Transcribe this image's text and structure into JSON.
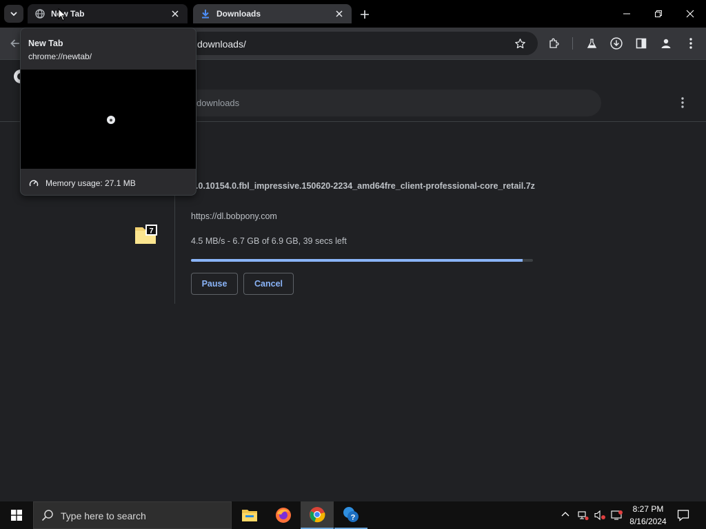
{
  "tabs": [
    {
      "title": "New Tab"
    },
    {
      "title": "Downloads"
    }
  ],
  "address_bar": {
    "url": "downloads/"
  },
  "downloads_page": {
    "search_placeholder": "downloads",
    "item": {
      "file_name": "0.0.10154.0.fbl_impressive.150620-2234_amd64fre_client-professional-core_retail.7z",
      "source_url": "https://dl.bobpony.com",
      "status": "4.5 MB/s - 6.7 GB of 6.9 GB, 39 secs left",
      "progress_fraction": 0.97,
      "pause_label": "Pause",
      "cancel_label": "Cancel",
      "file_icon": "7z-archive-icon"
    }
  },
  "hover_card": {
    "title": "New Tab",
    "url": "chrome://newtab/",
    "memory": "Memory usage: 27.1 MB"
  },
  "taskbar": {
    "search_placeholder": "Type here to search",
    "time": "8:27 PM",
    "date": "8/16/2024",
    "apps": [
      "file-explorer-icon",
      "firefox-icon",
      "chrome-icon",
      "get-help-icon"
    ]
  },
  "colors": {
    "accent": "#8ab4f8",
    "page_bg": "#202124",
    "toolbar_bg": "#35363a"
  }
}
